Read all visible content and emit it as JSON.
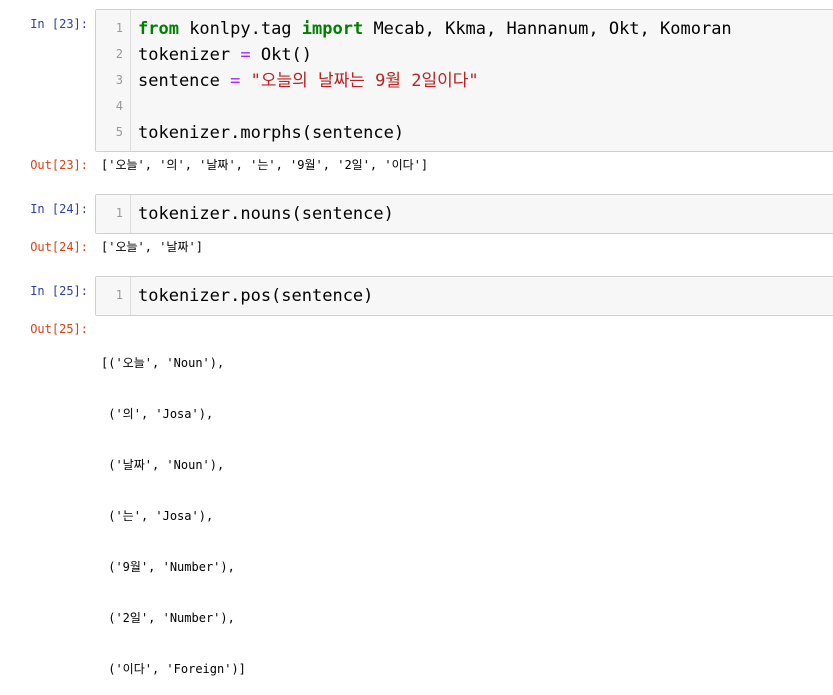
{
  "cells": [
    {
      "in_prompt": "In [23]:",
      "line_numbers": [
        "1",
        "2",
        "3",
        "4",
        "5"
      ],
      "code": {
        "l1_kw1": "from",
        "l1_mid": " konlpy.tag ",
        "l1_kw2": "import",
        "l1_rest": " Mecab, Kkma, Hannanum, Okt, Komoran",
        "l2_a": "tokenizer ",
        "l2_op": "=",
        "l2_b": " Okt()",
        "l3_a": "sentence ",
        "l3_op": "=",
        "l3_str": " \"오늘의 날짜는 9월 2일이다\"",
        "l4": "",
        "l5": "tokenizer.morphs(sentence)"
      },
      "out_prompt": "Out[23]:",
      "output": "['오늘', '의', '날짜', '는', '9월', '2일', '이다']"
    },
    {
      "in_prompt": "In [24]:",
      "line_numbers": [
        "1"
      ],
      "code": {
        "l1": "tokenizer.nouns(sentence)"
      },
      "out_prompt": "Out[24]:",
      "output": "['오늘', '날짜']"
    },
    {
      "in_prompt": "In [25]:",
      "line_numbers": [
        "1"
      ],
      "code": {
        "l1": "tokenizer.pos(sentence)"
      },
      "out_prompt": "Out[25]:",
      "output_lines": [
        "[('오늘', 'Noun'),",
        " ('의', 'Josa'),",
        " ('날짜', 'Noun'),",
        " ('는', 'Josa'),",
        " ('9월', 'Number'),",
        " ('2일', 'Number'),",
        " ('이다', 'Foreign')]"
      ]
    }
  ],
  "colors": {
    "in_prompt": "#303f9f",
    "out_prompt": "#d84315",
    "keyword": "#008000",
    "operator": "#aa22ff",
    "string": "#ba2121",
    "cell_bg": "#f7f7f7"
  }
}
